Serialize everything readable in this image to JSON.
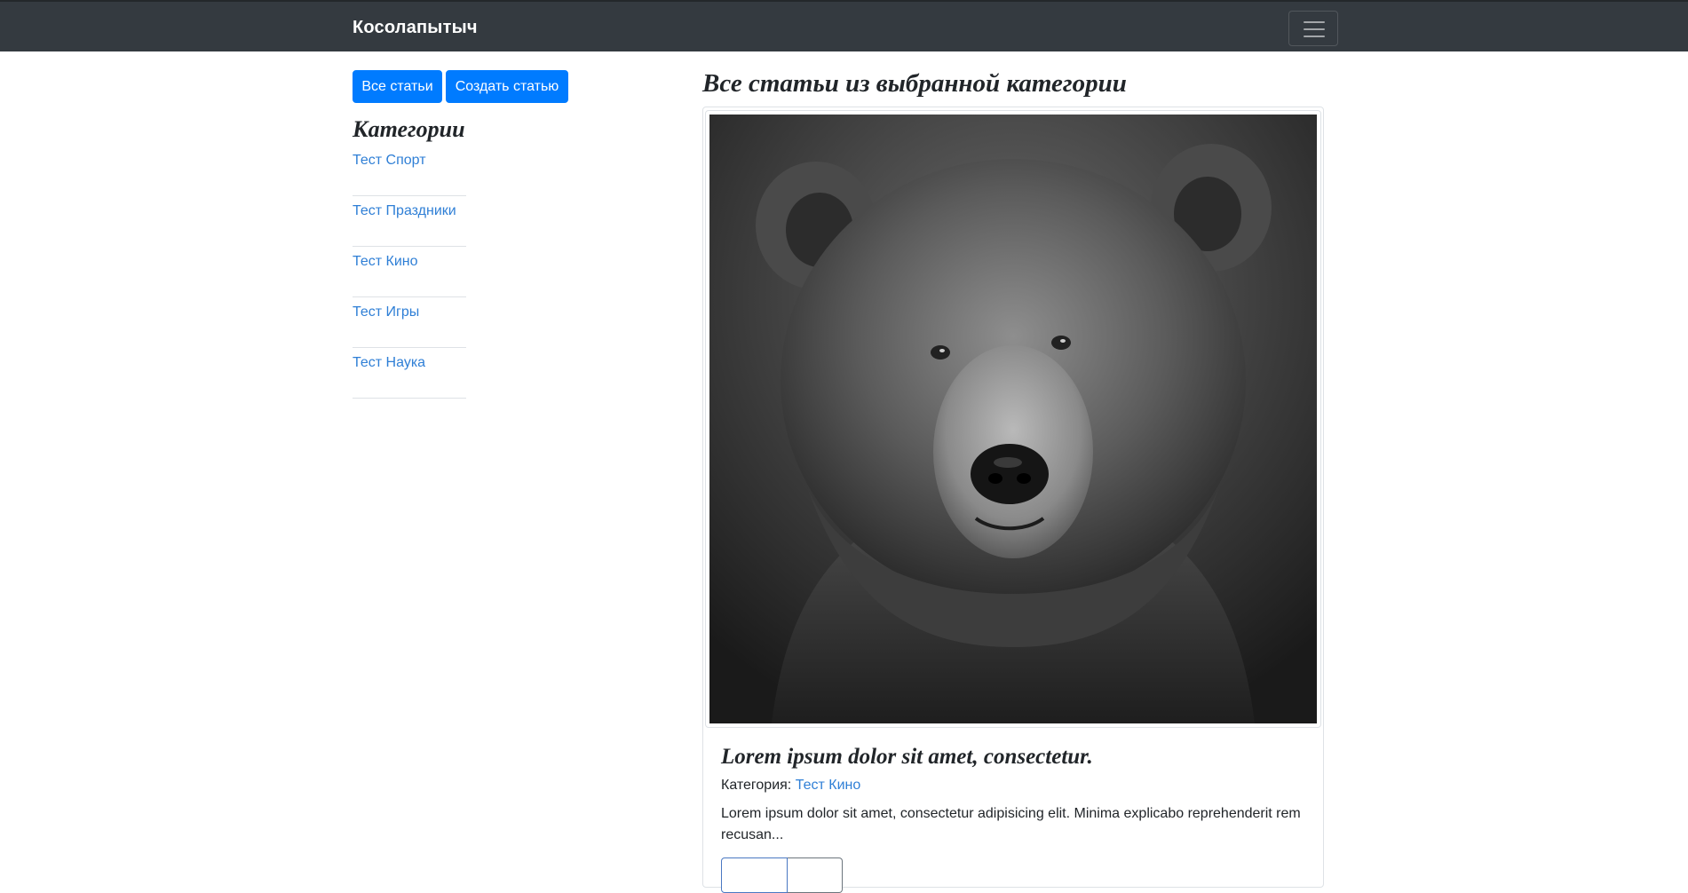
{
  "navbar": {
    "brand": "Косолапытыч",
    "toggler_icon": "hamburger-menu-icon",
    "background": "#343a40"
  },
  "sidebar": {
    "buttons": {
      "all_articles": "Все статьи",
      "create_article": "Создать статью"
    },
    "categories_title": "Категории",
    "categories": [
      {
        "label": "Тест Спорт"
      },
      {
        "label": "Тест Праздники"
      },
      {
        "label": "Тест Кино"
      },
      {
        "label": "Тест Игры"
      },
      {
        "label": "Тест Наука"
      }
    ]
  },
  "main": {
    "title": "Все статьи из выбранной категории",
    "article": {
      "image": "bear-portrait-photo",
      "title": "Lorem ipsum dolor sit amet, consectetur.",
      "category_prefix": "Категория:",
      "category_link": "Тест Кино",
      "excerpt": "Lorem ipsum dolor sit amet, consectetur adipisicing elit. Minima explicabo reprehenderit rem recusan..."
    }
  },
  "colors": {
    "primary": "#007bff",
    "link": "#2f7fd6",
    "text": "#212529",
    "divider": "#dee2e6"
  }
}
